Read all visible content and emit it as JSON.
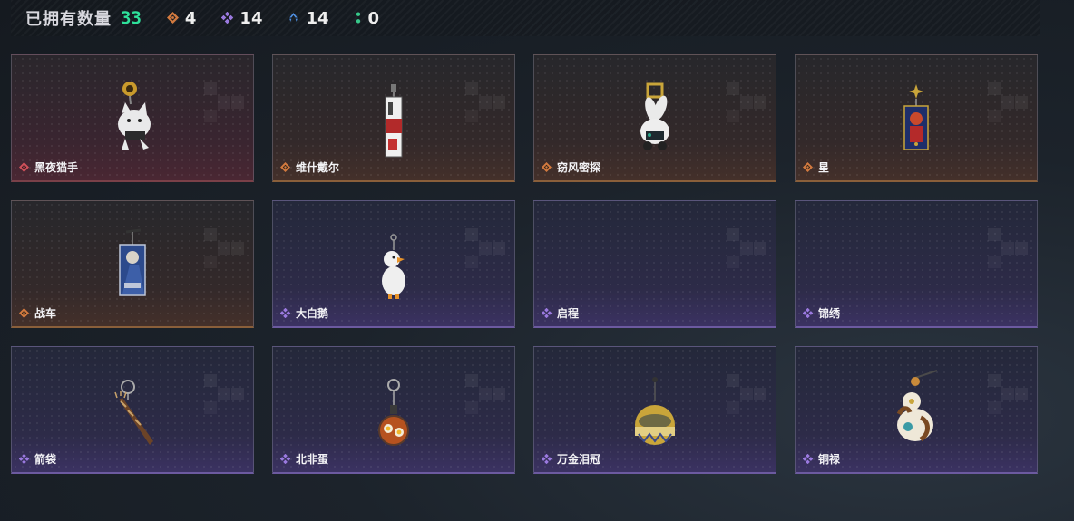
{
  "header": {
    "owned_label": "已拥有数量",
    "owned_count": "33",
    "stats": [
      {
        "icon": "orange-diamond-icon",
        "value": "4",
        "color": "#d37a3f"
      },
      {
        "icon": "purple-diamond-icon",
        "value": "14",
        "color": "#9b7ae0"
      },
      {
        "icon": "blue-chevron-icon",
        "value": "14",
        "color": "#4f8fe0"
      },
      {
        "icon": "green-dots-icon",
        "value": "0",
        "color": "#37c98a"
      }
    ]
  },
  "colors": {
    "owned_count": "#2ee09a",
    "red": "#d0505a",
    "orange": "#d37a3f",
    "purple": "#9b7ae0"
  },
  "items": [
    {
      "name": "黑夜猫手",
      "rarity": "red",
      "icon": "cat-keychain-icon"
    },
    {
      "name": "维什戴尔",
      "rarity": "orange",
      "icon": "tag-keychain-icon"
    },
    {
      "name": "窃风密探",
      "rarity": "orange",
      "icon": "bunny-keychain-icon"
    },
    {
      "name": "星",
      "rarity": "orange",
      "icon": "card-keychain-icon"
    },
    {
      "name": "战车",
      "rarity": "orange",
      "icon": "card-keychain-icon"
    },
    {
      "name": "大白鹅",
      "rarity": "purple",
      "icon": "goose-keychain-icon"
    },
    {
      "name": "启程",
      "rarity": "purple",
      "icon": ""
    },
    {
      "name": "锦绣",
      "rarity": "purple",
      "icon": ""
    },
    {
      "name": "箭袋",
      "rarity": "purple",
      "icon": "quiver-keychain-icon"
    },
    {
      "name": "北非蛋",
      "rarity": "purple",
      "icon": "pan-keychain-icon"
    },
    {
      "name": "万金泪冠",
      "rarity": "purple",
      "icon": "crown-keychain-icon"
    },
    {
      "name": "铜禄",
      "rarity": "purple",
      "icon": "gourd-keychain-icon"
    }
  ]
}
